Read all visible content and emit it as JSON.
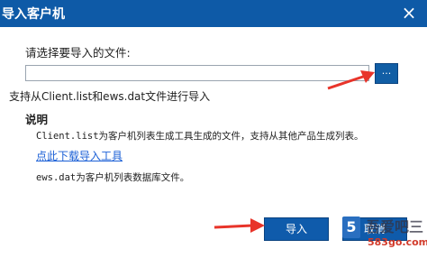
{
  "window": {
    "title": "导入客户机",
    "close_glyph": "×"
  },
  "form": {
    "select_label": "请选择要导入的文件:",
    "path_value": "",
    "browse_label": "...",
    "support_text": "支持从Client.list和ews.dat文件进行导入"
  },
  "note": {
    "title": "说明",
    "line1": "Client.list为客户机列表生成工具生成的文件，支持从其他产品生成列表。",
    "download_link": "点此下载导入工具",
    "line2": "ews.dat为客户机列表数据库文件。"
  },
  "buttons": {
    "import_label": "导入",
    "cancel_label": "取消"
  },
  "watermark": {
    "logo_glyph": "5",
    "site_name": "吾爱吧三",
    "site_url": "583go.com"
  },
  "colors": {
    "titlebar": "#0e5aa7",
    "button": "#0f5bab",
    "link": "#1a5fd6",
    "annotation_arrow": "#e8342a"
  },
  "annotations": {
    "arrow_icon": "red-arrow-icon"
  }
}
